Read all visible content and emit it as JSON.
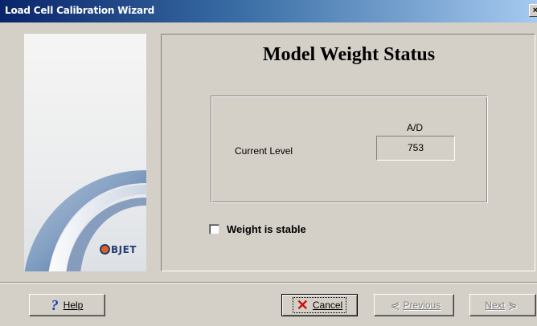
{
  "window": {
    "title": "Load Cell Calibration Wizard",
    "close_label": "×"
  },
  "brand": {
    "logo_text": "BJET"
  },
  "main": {
    "heading": "Model Weight Status",
    "ad_label": "A/D",
    "current_level_label": "Current Level",
    "current_level_value": "753",
    "weight_stable_label": "Weight is stable",
    "weight_stable_checked": false
  },
  "footer": {
    "help_label": "Help",
    "cancel_label": "Cancel",
    "previous_label": "Previous",
    "next_label": "Next"
  },
  "icons": {
    "help": "question-icon",
    "cancel": "x-icon",
    "previous": "arrow-left-icon",
    "next": "arrow-right-icon"
  }
}
